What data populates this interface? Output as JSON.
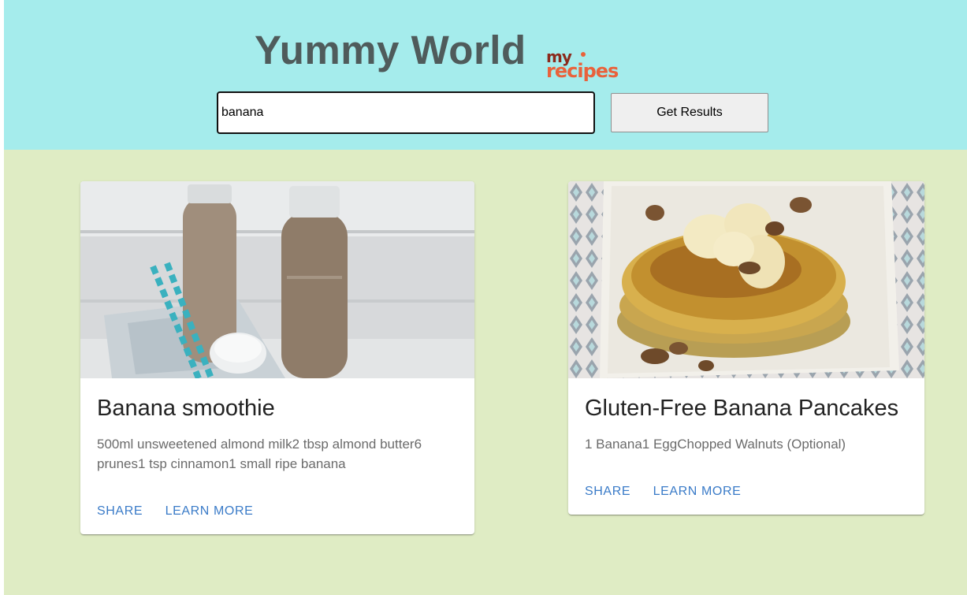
{
  "header": {
    "title": "Yummy World",
    "logo": {
      "line1": "my",
      "line2": "recipes",
      "colors": {
        "dark": "#8b2a1c",
        "accent": "#e9623b"
      }
    },
    "search": {
      "value": "banana",
      "placeholder": ""
    },
    "get_results_label": "Get Results"
  },
  "colors": {
    "header_bg": "#a5ecec",
    "page_bg": "#dfecc4",
    "link": "#3a7bc8"
  },
  "recipes": [
    {
      "title": "Banana smoothie",
      "ingredients": "500ml unsweetened almond milk2 tbsp almond butter6 prunes1 tsp cinnamon1 small ripe banana",
      "image": "smoothie-bottles-image",
      "share_label": "Share",
      "learn_more_label": "Learn More"
    },
    {
      "title": "Gluten-Free Banana Pancakes",
      "ingredients": "1 Banana1 EggChopped Walnuts (Optional)",
      "image": "banana-pancakes-image",
      "share_label": "Share",
      "learn_more_label": "Learn More"
    }
  ]
}
